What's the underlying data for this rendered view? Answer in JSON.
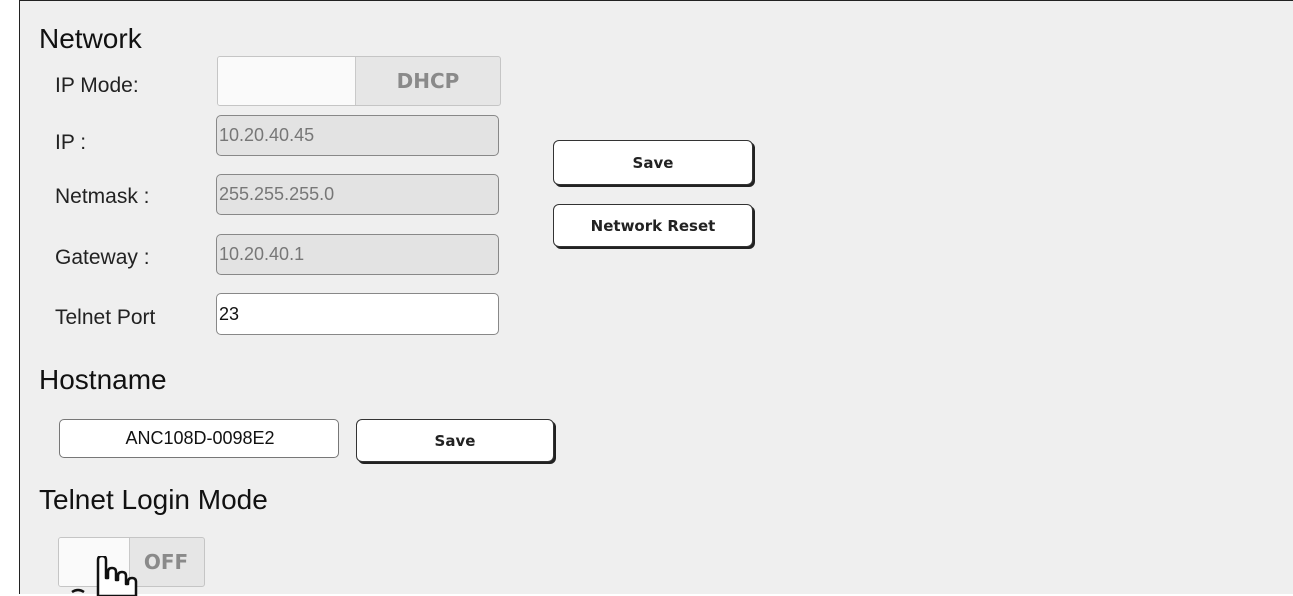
{
  "network": {
    "heading": "Network",
    "ip_mode": {
      "label": "IP Mode:",
      "value": "DHCP"
    },
    "ip": {
      "label": "IP :",
      "value": "10.20.40.45"
    },
    "netmask": {
      "label": "Netmask :",
      "value": "255.255.255.0"
    },
    "gateway": {
      "label": "Gateway :",
      "value": "10.20.40.1"
    },
    "telnet_port": {
      "label": "Telnet Port",
      "value": "23"
    },
    "save_label": "Save",
    "reset_label": "Network Reset"
  },
  "hostname": {
    "heading": "Hostname",
    "value": "ANC108D-0098E2",
    "save_label": "Save"
  },
  "telnet_login": {
    "heading": "Telnet Login Mode",
    "toggle_value": "OFF"
  },
  "cursor": {
    "icon": "hand-pointer-icon"
  }
}
